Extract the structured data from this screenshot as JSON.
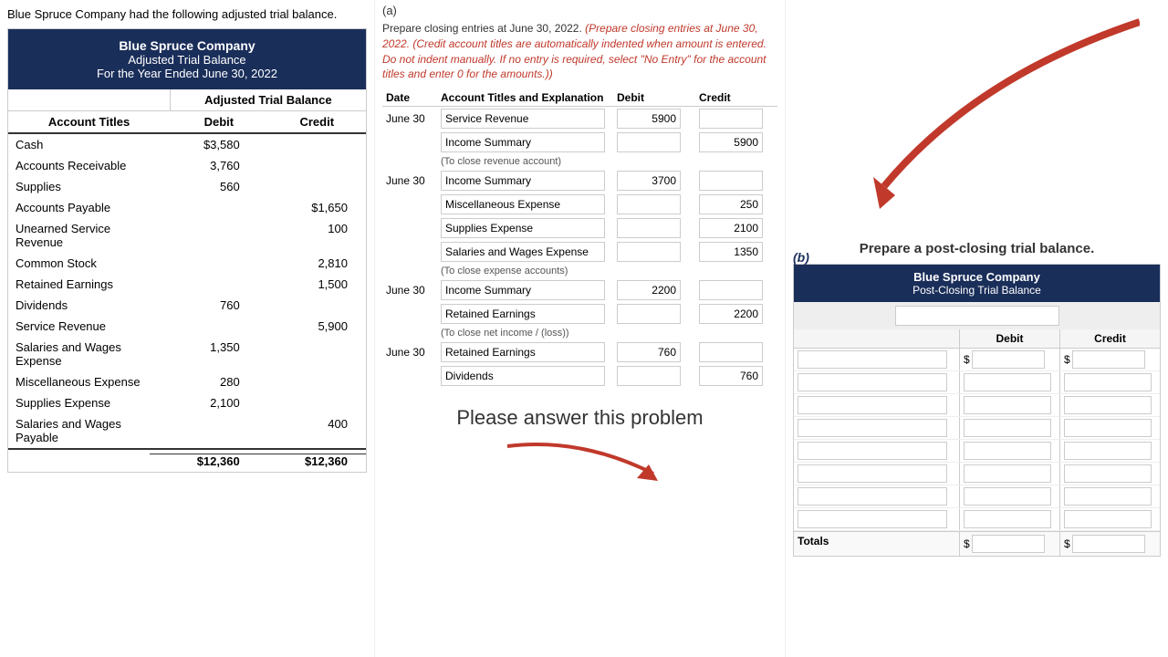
{
  "intro": {
    "text": "Blue Spruce Company had the following adjusted trial balance."
  },
  "trial_balance": {
    "company": "Blue Spruce Company",
    "subtitle": "Adjusted Trial Balance",
    "date_label": "For the Year Ended June 30, 2022",
    "col_label_account": "Account Titles",
    "col_label_debit": "Debit",
    "col_label_credit": "Credit",
    "adjusted_trial_label": "Adjusted Trial Balance",
    "rows": [
      {
        "account": "Cash",
        "debit": "$3,580",
        "credit": ""
      },
      {
        "account": "Accounts Receivable",
        "debit": "3,760",
        "credit": ""
      },
      {
        "account": "Supplies",
        "debit": "560",
        "credit": ""
      },
      {
        "account": "Accounts Payable",
        "debit": "",
        "credit": "$1,650"
      },
      {
        "account": "Unearned Service Revenue",
        "debit": "",
        "credit": "100"
      },
      {
        "account": "Common Stock",
        "debit": "",
        "credit": "2,810"
      },
      {
        "account": "Retained Earnings",
        "debit": "",
        "credit": "1,500"
      },
      {
        "account": "Dividends",
        "debit": "760",
        "credit": ""
      },
      {
        "account": "Service Revenue",
        "debit": "",
        "credit": "5,900"
      },
      {
        "account": "Salaries and Wages Expense",
        "debit": "1,350",
        "credit": ""
      },
      {
        "account": "Miscellaneous Expense",
        "debit": "280",
        "credit": ""
      },
      {
        "account": "Supplies Expense",
        "debit": "2,100",
        "credit": ""
      },
      {
        "account": "Salaries and Wages Payable",
        "debit": "",
        "credit": "400"
      }
    ],
    "totals": {
      "debit": "$12,360",
      "credit": "$12,360"
    }
  },
  "part_a": {
    "label": "(a)",
    "instructions": "Prepare closing entries at June 30, 2022. (Credit account titles are automatically indented when amount is entered. Do not indent manually. If no entry is required, select \"No Entry\" for the account titles and enter 0 for the amounts.)",
    "table_headers": {
      "date": "Date",
      "account": "Account Titles and Explanation",
      "debit": "Debit",
      "credit": "Credit"
    },
    "entries": [
      {
        "date": "June 30",
        "rows": [
          {
            "account": "Service Revenue",
            "debit": "5900",
            "credit": ""
          },
          {
            "account": "Income Summary",
            "debit": "",
            "credit": "5900"
          }
        ],
        "note": "(To close revenue account)"
      },
      {
        "date": "June 30",
        "rows": [
          {
            "account": "Income Summary",
            "debit": "3700",
            "credit": ""
          },
          {
            "account": "Miscellaneous Expense",
            "debit": "",
            "credit": "250"
          },
          {
            "account": "Supplies Expense",
            "debit": "",
            "credit": "2100"
          },
          {
            "account": "Salaries and Wages Expense",
            "debit": "",
            "credit": "1350"
          }
        ],
        "note": "(To close expense accounts)"
      },
      {
        "date": "June 30",
        "rows": [
          {
            "account": "Income Summary",
            "debit": "2200",
            "credit": ""
          },
          {
            "account": "Retained Earnings",
            "debit": "",
            "credit": "2200"
          }
        ],
        "note": "(To close net income / (loss))"
      },
      {
        "date": "June 30",
        "rows": [
          {
            "account": "Retained Earnings",
            "debit": "760",
            "credit": ""
          },
          {
            "account": "Dividends",
            "debit": "",
            "credit": "760"
          }
        ],
        "note": ""
      }
    ]
  },
  "please_answer": "Please answer this problem",
  "part_b": {
    "label": "(b)",
    "title": "Prepare a post-closing trial balance.",
    "company": "Blue Spruce Company",
    "subtitle": "Post-Closing Trial Balance",
    "name_placeholder": "",
    "col_debit": "Debit",
    "col_credit": "Credit",
    "totals_label": "Totals",
    "dollar_sign": "$"
  }
}
